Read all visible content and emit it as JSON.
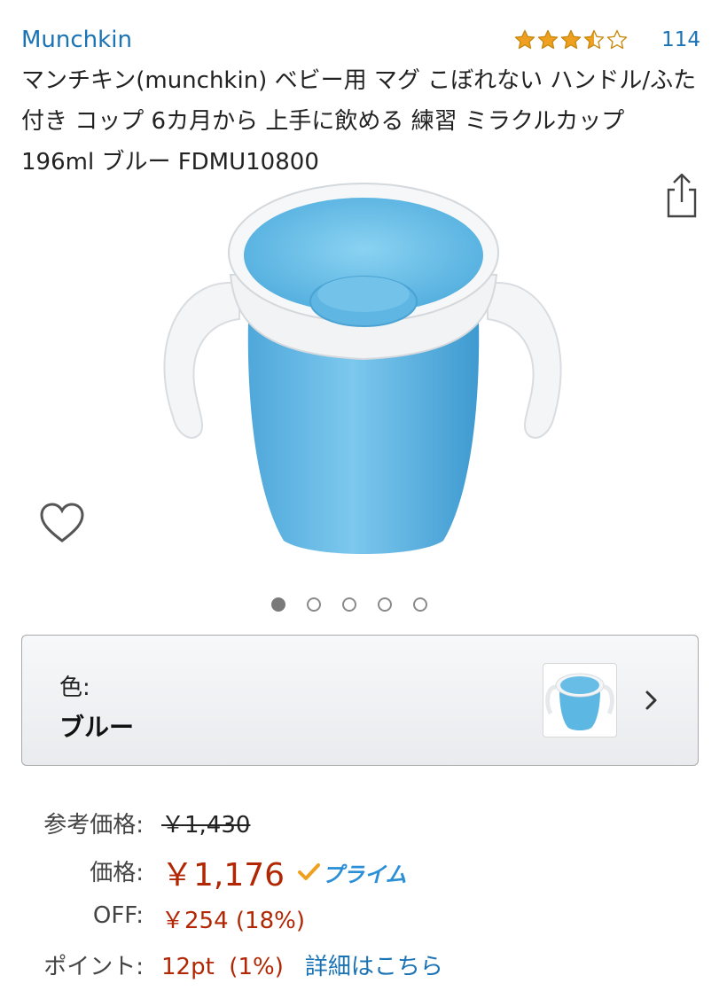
{
  "brand": "Munchkin",
  "rating": {
    "stars": 3.5,
    "max_stars": 5,
    "review_count": "114"
  },
  "title": "マンチキン(munchkin) ベビー用 マグ こぼれない ハンドル/ふた 付き コップ 6カ月から 上手に飲める 練習 ミラクルカップ 196ml ブルー FDMU10800",
  "gallery": {
    "image_count": 5,
    "active_index": 0
  },
  "variant": {
    "label": "色:",
    "value": "ブルー"
  },
  "pricing": {
    "list_price_label": "参考価格:",
    "list_price": "￥1,430",
    "price_label": "価格:",
    "price": "￥1,176",
    "prime_label": "プライム",
    "off_label": "OFF:",
    "off_value": "￥254 (18%)",
    "points_label": "ポイント:",
    "points_value": "12pt  (1%)",
    "details_link": "詳細はこちら"
  },
  "colors": {
    "link": "#1a73b5",
    "price": "#b12704",
    "star": "#f0a020",
    "prime": "#2a8fd6",
    "cup": "#5cb7e3"
  },
  "icons": {
    "share": "share-icon",
    "wishlist": "heart-icon",
    "variant_open": "chevron-right-icon"
  }
}
